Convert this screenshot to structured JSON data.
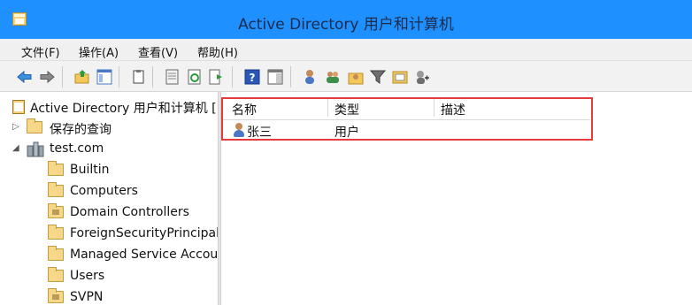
{
  "window": {
    "title": "Active Directory 用户和计算机"
  },
  "menu": {
    "items": [
      "文件(F)",
      "操作(A)",
      "查看(V)",
      "帮助(H)"
    ]
  },
  "toolbar": {
    "buttons": [
      "back-arrow-icon",
      "forward-arrow-icon",
      "up-folder-icon",
      "show-tree-icon",
      "copy-icon",
      "properties-icon",
      "refresh-icon",
      "export-list-icon",
      "help-icon",
      "action-pane-icon",
      "add-user-icon",
      "add-users-icon",
      "add-group-icon",
      "filter-icon",
      "add-ou-icon",
      "add-to-group-icon"
    ]
  },
  "tree": {
    "root_label": "Active Directory 用户和计算机 [",
    "items": [
      {
        "label": "保存的查询",
        "icon": "folder-icon"
      },
      {
        "label": "test.com",
        "icon": "domain-icon"
      },
      {
        "label": "Builtin",
        "icon": "folder-icon"
      },
      {
        "label": "Computers",
        "icon": "folder-icon"
      },
      {
        "label": "Domain Controllers",
        "icon": "ou-folder-icon"
      },
      {
        "label": "ForeignSecurityPrincipal",
        "icon": "folder-icon"
      },
      {
        "label": "Managed Service Accou",
        "icon": "folder-icon"
      },
      {
        "label": "Users",
        "icon": "folder-icon"
      },
      {
        "label": "SVPN",
        "icon": "ou-folder-icon"
      }
    ]
  },
  "list": {
    "columns": [
      "名称",
      "类型",
      "描述"
    ],
    "rows": [
      {
        "name": "张三",
        "type": "用户",
        "description": ""
      }
    ]
  },
  "colors": {
    "titlebar": "#1e90ff",
    "highlight_border": "#e63b3b"
  }
}
